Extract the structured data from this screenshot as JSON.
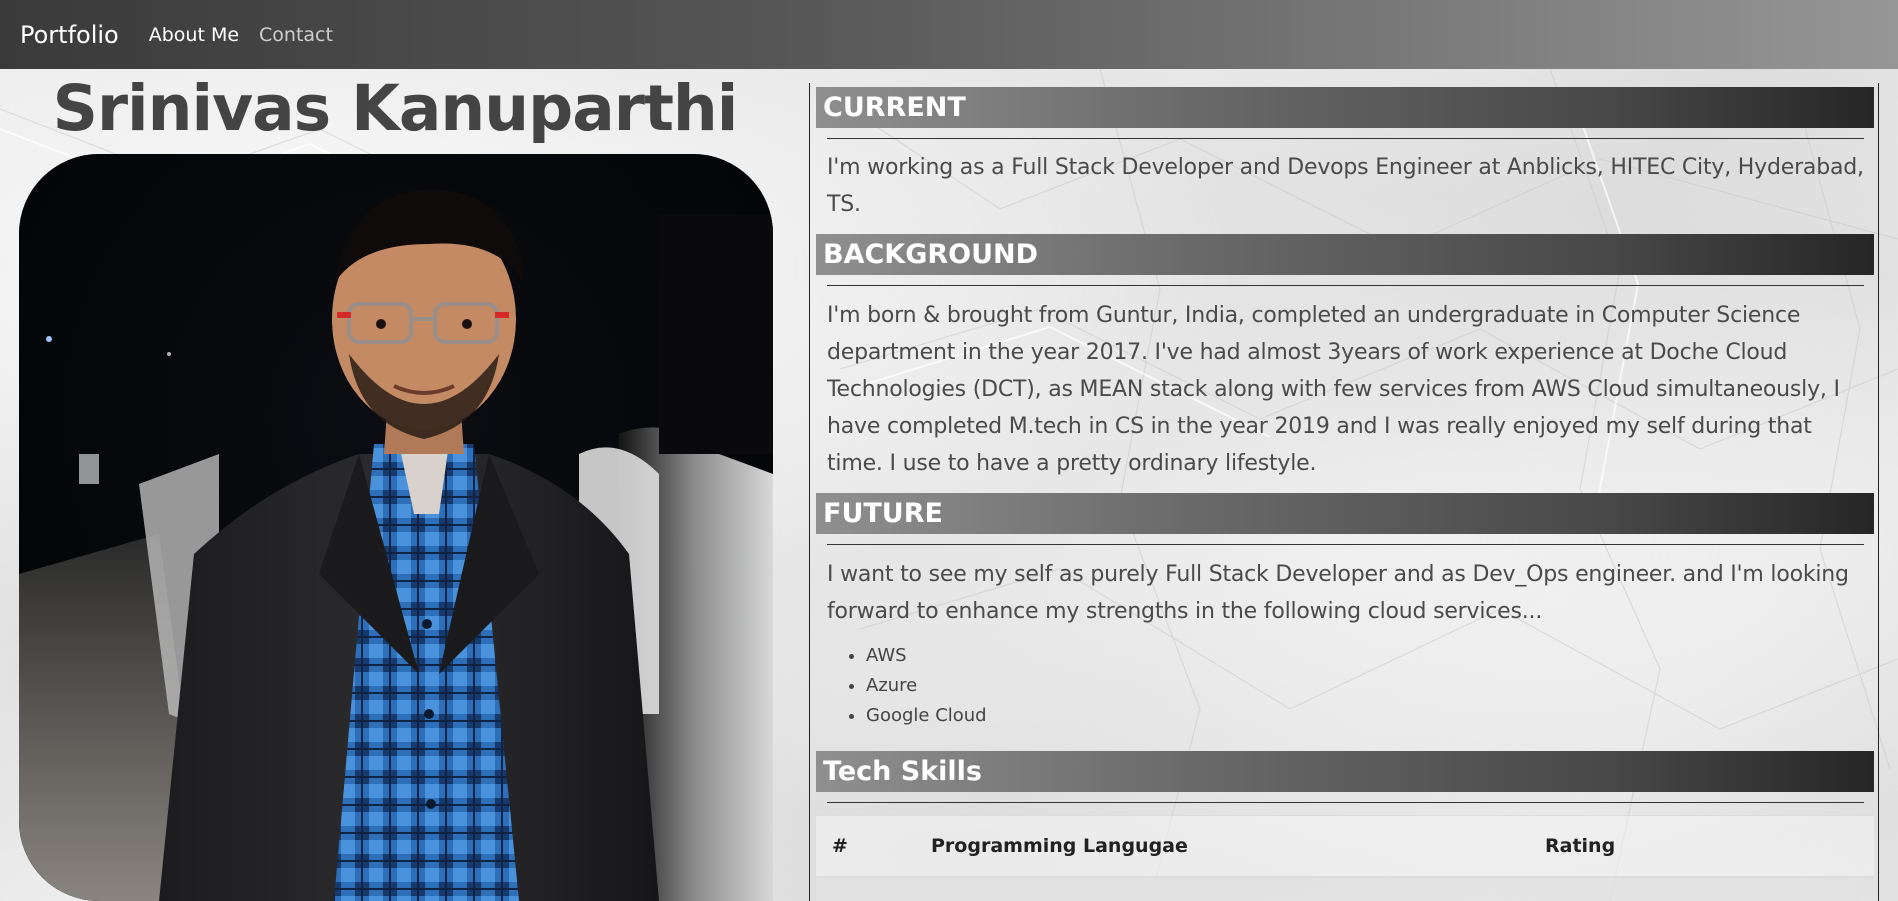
{
  "navbar": {
    "brand": "Portfolio",
    "links": [
      {
        "label": "About Me",
        "active": true
      },
      {
        "label": "Contact",
        "active": false
      }
    ]
  },
  "profile": {
    "name": "Srinivas Kanuparthi"
  },
  "sections": {
    "current": {
      "heading": "CURRENT",
      "text": "I'm working as a Full Stack Developer and Devops Engineer at Anblicks, HITEC City, Hyderabad, TS."
    },
    "background": {
      "heading": "BACKGROUND",
      "text": "I'm born & brought from Guntur, India, completed an undergraduate in Computer Science department in the year 2017. I've had almost 3years of work experience at Doche Cloud Technologies (DCT), as MEAN stack along with few services from AWS Cloud simultaneously, I have completed M.tech in CS in the year 2019 and I was really enjoyed my self during that time. I use to have a pretty ordinary lifestyle."
    },
    "future": {
      "heading": "FUTURE",
      "text": "I want to see my self as purely Full Stack Developer and as Dev_Ops engineer. and I'm looking forward to enhance my strengths in the following cloud services...",
      "items": [
        "AWS",
        "Azure",
        "Google Cloud"
      ]
    },
    "tech_skills": {
      "heading": "Tech Skills",
      "columns": [
        "#",
        "Programming Langugae",
        "Rating"
      ]
    }
  },
  "colors": {
    "navbar_dark": "#3a3a3a",
    "section_bar_dark": "#262626",
    "name_text": "#444444"
  }
}
